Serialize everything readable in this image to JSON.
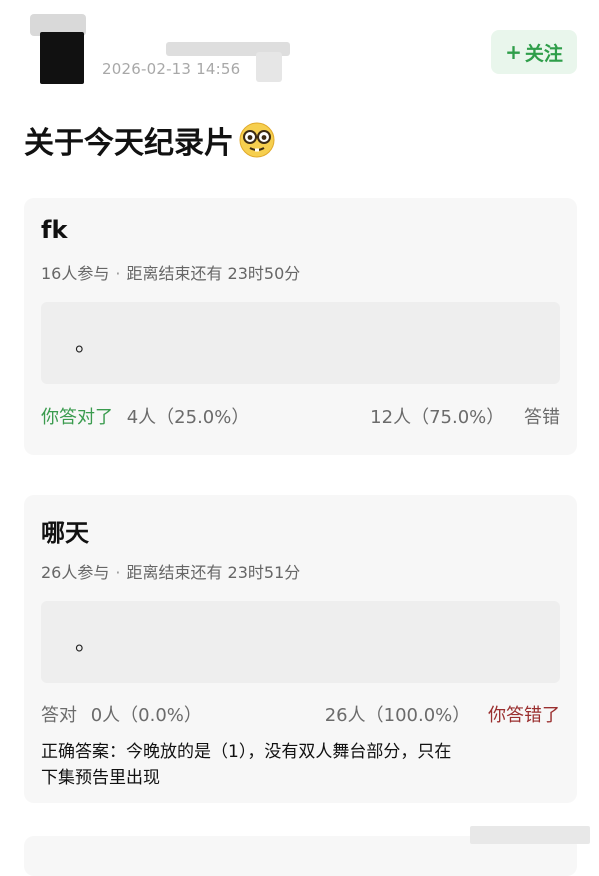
{
  "header": {
    "timestamp": "2026-02-13 14:56",
    "follow_label": "关注",
    "follow_plus": "+"
  },
  "post": {
    "title": "关于今天纪录片"
  },
  "polls": [
    {
      "question": "fk",
      "participants": "16人参与",
      "separator": "·",
      "time_left": "距离结束还有 23时50分",
      "option": "。",
      "left_label": "你答对了",
      "left_stat": "4人（25.0%）",
      "right_stat": "12人（75.0%）",
      "right_label": "答错"
    },
    {
      "question": "哪天",
      "participants": "26人参与",
      "separator": "·",
      "time_left": "距离结束还有 23时51分",
      "option": "。",
      "left_label": "答对",
      "left_stat": "0人（0.0%）",
      "right_stat": "26人（100.0%）",
      "right_label": "你答错了",
      "answer_line1": "正确答案：今晚放的是（1），没有双人舞台部分，只在",
      "answer_line2": "下集预告里出现"
    }
  ],
  "colors": {
    "follow_text": "#2f9e4a",
    "follow_bg": "#e9f6ec",
    "correct": "#3a9b4e",
    "wrong": "#9a2f2f"
  }
}
